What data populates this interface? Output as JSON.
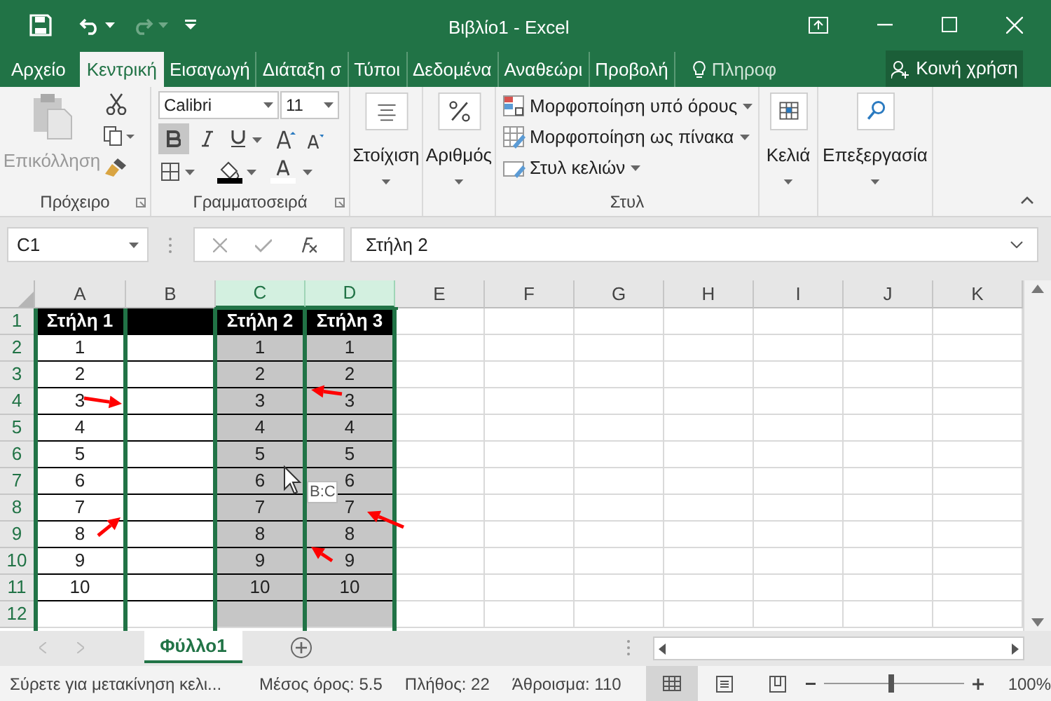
{
  "window": {
    "title": "Βιβλίο1 - Excel"
  },
  "tabs": [
    {
      "label": "Αρχείο",
      "selected": false
    },
    {
      "label": "Κεντρική",
      "selected": true
    },
    {
      "label": "Εισαγωγή",
      "selected": false
    },
    {
      "label": "Διάταξη σ",
      "selected": false
    },
    {
      "label": "Τύποι",
      "selected": false
    },
    {
      "label": "Δεδομένα",
      "selected": false
    },
    {
      "label": "Αναθεώρι",
      "selected": false
    },
    {
      "label": "Προβολή",
      "selected": false
    }
  ],
  "tell_me": {
    "placeholder": "Πληροφ"
  },
  "share_button": "Κοινή χρήση",
  "ribbon": {
    "clipboard": {
      "paste": "Επικόλληση",
      "label": "Πρόχειρο"
    },
    "font": {
      "family": "Calibri",
      "size": "11",
      "label": "Γραμματοσειρά",
      "bold": true
    },
    "alignment": "Στοίχιση",
    "number": "Αριθμός",
    "styles": {
      "items": [
        "Μορφοποίηση υπό όρους",
        "Μορφοποίηση ως πίνακα",
        "Στυλ κελιών"
      ],
      "label": "Στυλ"
    },
    "cells": "Κελιά",
    "editing": "Επεξεργασία"
  },
  "name_box": "C1",
  "formula": "Στήλη 2",
  "columns": [
    {
      "label": "A",
      "selected": false
    },
    {
      "label": "B",
      "selected": false
    },
    {
      "label": "C",
      "selected": true
    },
    {
      "label": "D",
      "selected": true
    },
    {
      "label": "E",
      "selected": false
    },
    {
      "label": "F",
      "selected": false
    },
    {
      "label": "G",
      "selected": false
    },
    {
      "label": "H",
      "selected": false
    },
    {
      "label": "I",
      "selected": false
    },
    {
      "label": "J",
      "selected": false
    },
    {
      "label": "K",
      "selected": false
    }
  ],
  "rows": [
    {
      "number": "1",
      "kind": "header",
      "cells": {
        "A": "Στήλη 1",
        "C": "Στήλη 2",
        "D": "Στήλη 3"
      }
    },
    {
      "number": "2",
      "kind": "data",
      "cells": {
        "A": "1",
        "C": "1",
        "D": "1"
      }
    },
    {
      "number": "3",
      "kind": "data",
      "cells": {
        "A": "2",
        "C": "2",
        "D": "2"
      }
    },
    {
      "number": "4",
      "kind": "data",
      "cells": {
        "A": "3",
        "C": "3",
        "D": "3"
      }
    },
    {
      "number": "5",
      "kind": "data",
      "cells": {
        "A": "4",
        "C": "4",
        "D": "4"
      }
    },
    {
      "number": "6",
      "kind": "data",
      "cells": {
        "A": "5",
        "C": "5",
        "D": "5"
      }
    },
    {
      "number": "7",
      "kind": "data",
      "cells": {
        "A": "6",
        "C": "6",
        "D": "6"
      }
    },
    {
      "number": "8",
      "kind": "data",
      "cells": {
        "A": "7",
        "C": "7",
        "D": "7"
      }
    },
    {
      "number": "9",
      "kind": "data",
      "cells": {
        "A": "8",
        "C": "8",
        "D": "8"
      }
    },
    {
      "number": "10",
      "kind": "data",
      "cells": {
        "A": "9",
        "C": "9",
        "D": "9"
      }
    },
    {
      "number": "11",
      "kind": "data",
      "cells": {
        "A": "10",
        "C": "10",
        "D": "10"
      }
    },
    {
      "number": "12",
      "kind": "blank",
      "cells": {}
    }
  ],
  "drag_tooltip": "B:C",
  "sheets": [
    {
      "label": "Φύλλο1",
      "selected": true
    }
  ],
  "status_bar": {
    "message": "Σύρετε για μετακίνηση κελι...",
    "average": "Μέσος όρος: 5.5",
    "count": "Πλήθος: 22",
    "sum": "Άθροισμα: 110",
    "zoom": {
      "level": 0.48,
      "reading": "100%"
    }
  }
}
